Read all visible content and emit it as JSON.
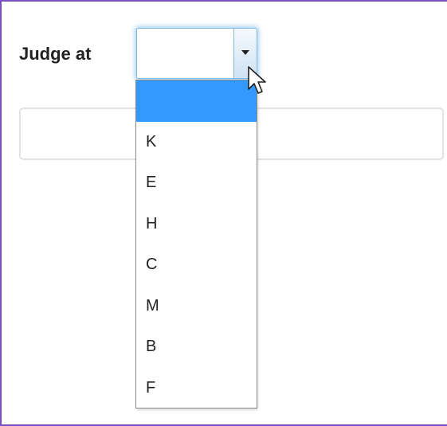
{
  "form": {
    "label": "Judge at",
    "select": {
      "current_value": "",
      "options": [
        {
          "label": "",
          "selected": true
        },
        {
          "label": "K",
          "selected": false
        },
        {
          "label": "E",
          "selected": false
        },
        {
          "label": "H",
          "selected": false
        },
        {
          "label": "C",
          "selected": false
        },
        {
          "label": "M",
          "selected": false
        },
        {
          "label": "B",
          "selected": false
        },
        {
          "label": "F",
          "selected": false
        }
      ]
    },
    "text_box": {
      "value": ""
    }
  },
  "icons": {
    "dropdown_arrow": "chevron-down-icon",
    "cursor": "mouse-pointer-icon"
  },
  "colors": {
    "frame_border": "#7a4fc4",
    "selected_option": "#3399ff",
    "focus_glow": "#66afe9"
  }
}
